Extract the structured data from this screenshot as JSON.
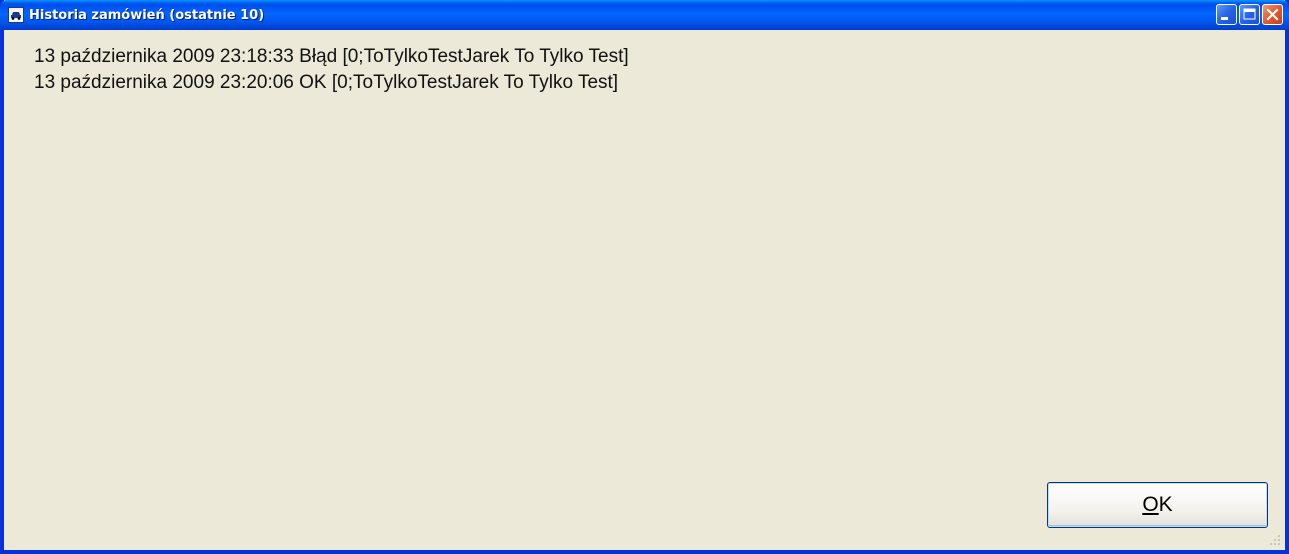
{
  "window": {
    "title": "Historia zamówień (ostatnie 10)",
    "icon": "car-icon"
  },
  "caption_buttons": {
    "minimize_icon": "minimize-icon",
    "maximize_icon": "maximize-icon",
    "close_icon": "close-icon"
  },
  "history": {
    "lines": [
      "13 października 2009 23:18:33 Błąd [0;ToTylkoTestJarek To Tylko Test]",
      "13 października 2009 23:20:06 OK [0;ToTylkoTestJarek To Tylko Test]"
    ]
  },
  "footer": {
    "ok_mnemonic": "O",
    "ok_rest": "K"
  },
  "colors": {
    "titlebar": "#0058f0",
    "window_bg": "#ece9d8",
    "close_button": "#e25a2c"
  }
}
